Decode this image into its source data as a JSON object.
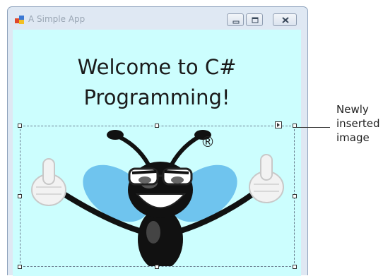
{
  "window": {
    "title": "A Simple App",
    "controls": {
      "minimize_icon": "minimize-icon",
      "maximize_icon": "maximize-icon",
      "close_icon": "close-icon"
    }
  },
  "form": {
    "background_color": "#ccfefe",
    "heading_line1": "Welcome to C#",
    "heading_line2": "Programming!"
  },
  "picture": {
    "image_icon": "bug-mascot-thumbs-up",
    "registered_mark": "®",
    "selected": true
  },
  "annotation": {
    "line1": "Newly",
    "line2": "inserted",
    "line3": "image"
  }
}
